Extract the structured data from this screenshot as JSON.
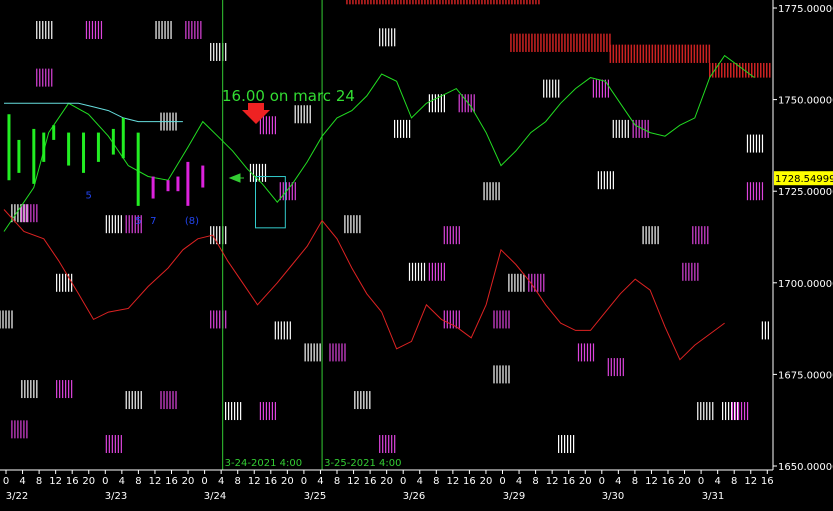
{
  "chart_data": {
    "type": "line",
    "title": "",
    "y_axis": {
      "min": 1650,
      "max": 1775,
      "ticks": [
        "1650.00000",
        "1675.00000",
        "1700.00000",
        "1725.00000",
        "1750.00000",
        "1775.00000"
      ],
      "tick_values": [
        1650,
        1675,
        1700,
        1725,
        1750,
        1775
      ],
      "current_price_label": "1728.54999",
      "current_price": 1728.55
    },
    "x_axis": {
      "hour_ticks": [
        "0",
        "4",
        "8",
        "12",
        "16",
        "20",
        "0",
        "4",
        "8",
        "12",
        "16",
        "20",
        "0",
        "4",
        "8",
        "12",
        "16",
        "20",
        "0",
        "4",
        "8",
        "12",
        "16",
        "20",
        "0",
        "4",
        "8",
        "12",
        "16",
        "20",
        "0",
        "4",
        "8",
        "12",
        "16",
        "20",
        "0",
        "4",
        "8",
        "12",
        "16",
        "20",
        "0",
        "4",
        "8",
        "12",
        "16",
        "20",
        "0",
        "4",
        "8",
        "12"
      ],
      "date_labels": [
        "3/22",
        "3/23",
        "3/24",
        "3/25",
        "3/26",
        "3/29",
        "3/30",
        "3/31"
      ]
    },
    "annotation": {
      "text": "16.00 on marc 24",
      "arrow": "down"
    },
    "vertical_lines": [
      "3-24-2021 4:00",
      "3-25-2021 4:00"
    ],
    "series": [
      {
        "color": "#22dd22",
        "points": [
          [
            0,
            1714
          ],
          [
            6,
            1726
          ],
          [
            9,
            1741
          ],
          [
            13,
            1749
          ],
          [
            17,
            1746
          ],
          [
            21,
            1740
          ],
          [
            25,
            1732
          ],
          [
            29,
            1729
          ],
          [
            33,
            1728
          ],
          [
            37,
            1737
          ],
          [
            40,
            1744
          ],
          [
            43,
            1740
          ],
          [
            46,
            1736
          ],
          [
            49,
            1731
          ],
          [
            52,
            1727
          ],
          [
            55,
            1722
          ],
          [
            58,
            1727
          ],
          [
            61,
            1733
          ],
          [
            64,
            1740
          ],
          [
            67,
            1745
          ],
          [
            70,
            1747
          ],
          [
            73,
            1751
          ],
          [
            76,
            1757
          ],
          [
            79,
            1755
          ],
          [
            82,
            1745
          ],
          [
            85,
            1749
          ],
          [
            88,
            1751
          ],
          [
            91,
            1753
          ],
          [
            94,
            1748
          ],
          [
            97,
            1741
          ],
          [
            100,
            1732
          ],
          [
            103,
            1736
          ],
          [
            106,
            1741
          ],
          [
            109,
            1744
          ],
          [
            112,
            1749
          ],
          [
            115,
            1753
          ],
          [
            118,
            1756
          ],
          [
            121,
            1755
          ],
          [
            124,
            1749
          ],
          [
            127,
            1743
          ],
          [
            130,
            1741
          ],
          [
            133,
            1740
          ],
          [
            136,
            1743
          ],
          [
            139,
            1745
          ],
          [
            142,
            1756
          ],
          [
            145,
            1762
          ],
          [
            148,
            1759
          ],
          [
            151,
            1756
          ]
        ]
      },
      {
        "color": "#dd2222",
        "points": [
          [
            0,
            1720
          ],
          [
            4,
            1714
          ],
          [
            8,
            1712
          ],
          [
            11,
            1706
          ],
          [
            15,
            1697
          ],
          [
            18,
            1690
          ],
          [
            21,
            1692
          ],
          [
            25,
            1693
          ],
          [
            29,
            1699
          ],
          [
            33,
            1704
          ],
          [
            36,
            1709
          ],
          [
            39,
            1712
          ],
          [
            42,
            1713
          ],
          [
            45,
            1706
          ],
          [
            48,
            1700
          ],
          [
            51,
            1694
          ],
          [
            55,
            1700
          ],
          [
            58,
            1705
          ],
          [
            61,
            1710
          ],
          [
            64,
            1717
          ],
          [
            67,
            1712
          ],
          [
            70,
            1704
          ],
          [
            73,
            1697
          ],
          [
            76,
            1692
          ],
          [
            79,
            1682
          ],
          [
            82,
            1684
          ],
          [
            85,
            1694
          ],
          [
            88,
            1690
          ],
          [
            91,
            1688
          ],
          [
            94,
            1685
          ],
          [
            97,
            1694
          ],
          [
            100,
            1709
          ],
          [
            103,
            1705
          ],
          [
            106,
            1700
          ],
          [
            109,
            1694
          ],
          [
            112,
            1689
          ],
          [
            115,
            1687
          ],
          [
            118,
            1687
          ],
          [
            121,
            1692
          ],
          [
            124,
            1697
          ],
          [
            127,
            1701
          ],
          [
            130,
            1698
          ],
          [
            133,
            1688
          ],
          [
            136,
            1679
          ],
          [
            139,
            1683
          ],
          [
            142,
            1686
          ],
          [
            145,
            1689
          ]
        ]
      },
      {
        "color": "#66dddd",
        "points": [
          [
            0,
            1749
          ],
          [
            12,
            1749
          ],
          [
            15,
            1749
          ],
          [
            18,
            1748
          ],
          [
            21,
            1747
          ],
          [
            24,
            1745
          ],
          [
            27,
            1744
          ],
          [
            33,
            1744
          ],
          [
            36,
            1744
          ]
        ]
      }
    ],
    "ohlc_bars": [
      {
        "x": 1,
        "high": 1746,
        "low": 1728,
        "color": "#22ee22"
      },
      {
        "x": 3,
        "high": 1739,
        "low": 1730,
        "color": "#22ee22"
      },
      {
        "x": 6,
        "high": 1742,
        "low": 1727,
        "color": "#22ee22"
      },
      {
        "x": 8,
        "high": 1741,
        "low": 1733,
        "color": "#22ee22"
      },
      {
        "x": 10,
        "high": 1743,
        "low": 1739,
        "color": "#22ee22"
      },
      {
        "x": 13,
        "high": 1741,
        "low": 1732,
        "color": "#22ee22"
      },
      {
        "x": 16,
        "high": 1741,
        "low": 1730,
        "color": "#22ee22"
      },
      {
        "x": 19,
        "high": 1741,
        "low": 1733,
        "color": "#22ee22"
      },
      {
        "x": 22,
        "high": 1742,
        "low": 1735,
        "color": "#22ee22"
      },
      {
        "x": 24,
        "high": 1745,
        "low": 1734,
        "color": "#22ee22"
      },
      {
        "x": 27,
        "high": 1741,
        "low": 1721,
        "color": "#22ee22"
      },
      {
        "x": 30,
        "high": 1729,
        "low": 1723,
        "color": "#dd22dd"
      },
      {
        "x": 33,
        "high": 1728,
        "low": 1725,
        "color": "#dd22dd"
      },
      {
        "x": 35,
        "high": 1729,
        "low": 1725,
        "color": "#dd22dd"
      },
      {
        "x": 37,
        "high": 1733,
        "low": 1721,
        "color": "#dd22dd"
      },
      {
        "x": 40,
        "high": 1732,
        "low": 1726,
        "color": "#dd22dd"
      }
    ],
    "bar_numbers": [
      "5",
      "5",
      "7",
      "(8)"
    ],
    "box": {
      "x0": 50,
      "x1": 56,
      "y0": 1729,
      "y1": 1715
    },
    "resistance_blocks": [
      {
        "x0": 69,
        "x1": 108,
        "y0": 1779,
        "y1": 1776
      },
      {
        "x0": 102,
        "x1": 122,
        "y0": 1768,
        "y1": 1763
      },
      {
        "x0": 122,
        "x1": 142,
        "y0": 1765,
        "y1": 1760
      },
      {
        "x0": 142,
        "x1": 156,
        "y0": 1760,
        "y1": 1756
      }
    ],
    "glyph_markers": [
      {
        "x": 8,
        "y": 1769,
        "color": "#ffffff"
      },
      {
        "x": 18,
        "y": 1769,
        "color": "#dd44dd"
      },
      {
        "x": 32,
        "y": 1769,
        "color": "#ffffff"
      },
      {
        "x": 38,
        "y": 1769,
        "color": "#dd44dd"
      },
      {
        "x": 8,
        "y": 1756,
        "color": "#dd44dd"
      },
      {
        "x": 43,
        "y": 1763,
        "color": "#ffffff"
      },
      {
        "x": 77,
        "y": 1767,
        "color": "#ffffff"
      },
      {
        "x": 33,
        "y": 1744,
        "color": "#ffffff"
      },
      {
        "x": 53,
        "y": 1743,
        "color": "#dd44dd"
      },
      {
        "x": 60,
        "y": 1746,
        "color": "#ffffff"
      },
      {
        "x": 80,
        "y": 1742,
        "color": "#ffffff"
      },
      {
        "x": 87,
        "y": 1749,
        "color": "#ffffff"
      },
      {
        "x": 93,
        "y": 1749,
        "color": "#dd44dd"
      },
      {
        "x": 110,
        "y": 1753,
        "color": "#ffffff"
      },
      {
        "x": 120,
        "y": 1753,
        "color": "#dd44dd"
      },
      {
        "x": 124,
        "y": 1742,
        "color": "#ffffff"
      },
      {
        "x": 128,
        "y": 1742,
        "color": "#dd44dd"
      },
      {
        "x": 151,
        "y": 1738,
        "color": "#ffffff"
      },
      {
        "x": 121,
        "y": 1728,
        "color": "#ffffff"
      },
      {
        "x": 151,
        "y": 1725,
        "color": "#dd44dd"
      },
      {
        "x": 98,
        "y": 1725,
        "color": "#ffffff"
      },
      {
        "x": 57,
        "y": 1725,
        "color": "#dd44dd"
      },
      {
        "x": 3,
        "y": 1719,
        "color": "#ffffff"
      },
      {
        "x": 5,
        "y": 1719,
        "color": "#dd44dd"
      },
      {
        "x": 22,
        "y": 1716,
        "color": "#ffffff"
      },
      {
        "x": 26,
        "y": 1716,
        "color": "#dd44dd"
      },
      {
        "x": 43,
        "y": 1713,
        "color": "#ffffff"
      },
      {
        "x": 51,
        "y": 1730,
        "color": "#ffffff"
      },
      {
        "x": 70,
        "y": 1716,
        "color": "#ffffff"
      },
      {
        "x": 90,
        "y": 1713,
        "color": "#dd44dd"
      },
      {
        "x": 130,
        "y": 1713,
        "color": "#ffffff"
      },
      {
        "x": 140,
        "y": 1713,
        "color": "#dd44dd"
      },
      {
        "x": 83,
        "y": 1703,
        "color": "#ffffff"
      },
      {
        "x": 87,
        "y": 1703,
        "color": "#dd44dd"
      },
      {
        "x": 103,
        "y": 1700,
        "color": "#ffffff"
      },
      {
        "x": 107,
        "y": 1700,
        "color": "#dd44dd"
      },
      {
        "x": 138,
        "y": 1703,
        "color": "#dd44dd"
      },
      {
        "x": 12,
        "y": 1700,
        "color": "#ffffff"
      },
      {
        "x": 0,
        "y": 1690,
        "color": "#ffffff"
      },
      {
        "x": 43,
        "y": 1690,
        "color": "#dd44dd"
      },
      {
        "x": 90,
        "y": 1690,
        "color": "#dd44dd"
      },
      {
        "x": 100,
        "y": 1690,
        "color": "#dd44dd"
      },
      {
        "x": 56,
        "y": 1687,
        "color": "#ffffff"
      },
      {
        "x": 154,
        "y": 1687,
        "color": "#ffffff"
      },
      {
        "x": 62,
        "y": 1681,
        "color": "#ffffff"
      },
      {
        "x": 67,
        "y": 1681,
        "color": "#dd44dd"
      },
      {
        "x": 117,
        "y": 1681,
        "color": "#dd44dd"
      },
      {
        "x": 123,
        "y": 1677,
        "color": "#dd44dd"
      },
      {
        "x": 100,
        "y": 1675,
        "color": "#ffffff"
      },
      {
        "x": 5,
        "y": 1671,
        "color": "#ffffff"
      },
      {
        "x": 12,
        "y": 1671,
        "color": "#dd44dd"
      },
      {
        "x": 26,
        "y": 1668,
        "color": "#ffffff"
      },
      {
        "x": 33,
        "y": 1668,
        "color": "#dd44dd"
      },
      {
        "x": 46,
        "y": 1665,
        "color": "#ffffff"
      },
      {
        "x": 53,
        "y": 1665,
        "color": "#dd44dd"
      },
      {
        "x": 72,
        "y": 1668,
        "color": "#ffffff"
      },
      {
        "x": 141,
        "y": 1665,
        "color": "#ffffff"
      },
      {
        "x": 146,
        "y": 1665,
        "color": "#ffffff"
      },
      {
        "x": 148,
        "y": 1665,
        "color": "#dd44dd"
      },
      {
        "x": 3,
        "y": 1660,
        "color": "#dd44dd"
      },
      {
        "x": 22,
        "y": 1656,
        "color": "#dd44dd"
      },
      {
        "x": 77,
        "y": 1656,
        "color": "#dd44dd"
      },
      {
        "x": 113,
        "y": 1656,
        "color": "#ffffff"
      }
    ],
    "colors": {
      "background": "#000000",
      "axis": "#ffffff",
      "vertical_line": "#33cc33",
      "box": "#33cccc",
      "annotation": "#33dd33",
      "arrow": "#ee2222",
      "price_tag_bg": "#ffff00",
      "bar_number": "#2244ee",
      "resistance": "#cc2222"
    }
  }
}
